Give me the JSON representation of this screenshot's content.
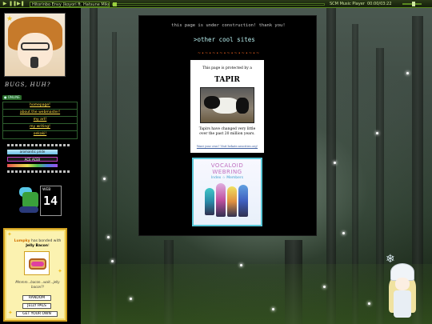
{
  "player": {
    "track": "Hitorinbo Envy (koyori ft. Hatsune Miku)",
    "name": "SCM Music Player",
    "time": "00:00/03:22"
  },
  "sidebar": {
    "tagline": "BUGS, HUH?",
    "online_badge": "● ONLINE",
    "nav": [
      "homepage!",
      "about the webmaster!",
      "my art!",
      "my writing!",
      "oekaki!"
    ],
    "badges": {
      "pride": "aromantic pride",
      "ace": "ACE",
      "ace_tag": "ACEII"
    },
    "webring_label": "WEB",
    "webring_number": "14",
    "pet": {
      "name": "Lumpky",
      "text_mid": " has bonded with ",
      "bonded": "Jelly Bacon",
      "text_end": "!",
      "quote": "Mmmm...bacon...wait...jelly bacon?!",
      "buttons": [
        "RANDOM",
        "JELLY PALS",
        "GET YOUR OWN"
      ]
    }
  },
  "main": {
    "notice": "this page is under construction! thank you!",
    "heading": ">other cool sites",
    "divider": "~•~•~•~•~•~•~•~•~",
    "tapir": {
      "protected": "This page is protected by a",
      "name": "TAPIR",
      "desc": "Tapirs have changed very little over the past 20 million years.",
      "link": "Want your own? Visit hekate.neocities.org!"
    },
    "vocaloid": {
      "line1": "VOCALOID",
      "line2": "WEBRING",
      "line3": "Index ☆ Members"
    }
  },
  "colors": {
    "accent_green": "#5a8a20",
    "nav_link": "#ffe04a",
    "heading_cyan": "#b8f0f0",
    "vocaloid_border": "#5ac8d8"
  }
}
